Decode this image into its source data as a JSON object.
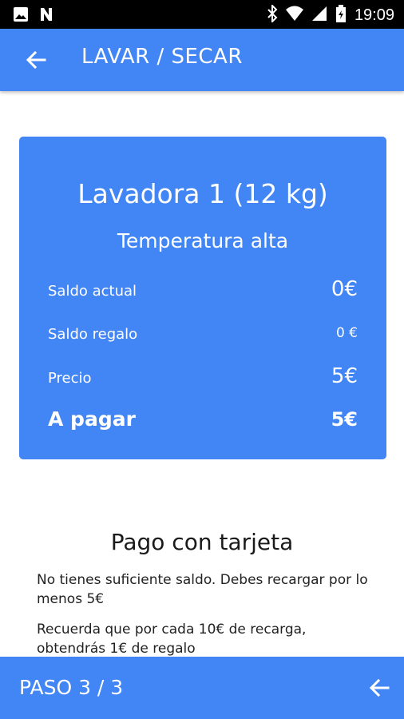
{
  "status_bar": {
    "time": "19:09",
    "icons": [
      "image-icon",
      "n-notification-icon",
      "bluetooth-icon",
      "wifi-icon",
      "signal-icon",
      "battery-icon"
    ]
  },
  "app_bar": {
    "title": "LAVAR / SECAR",
    "back_icon": "arrow-back-icon",
    "background": "#4285f4"
  },
  "summary_card": {
    "machine": "Lavadora 1 (12 kg)",
    "program": "Temperatura alta",
    "rows": [
      {
        "label": "Saldo actual",
        "value": "0€"
      },
      {
        "label": "Saldo regalo",
        "value": "0 €"
      },
      {
        "label": "Precio",
        "value": "5€"
      },
      {
        "label": "A pagar",
        "value": "5€"
      }
    ],
    "background": "#4285f4"
  },
  "payment": {
    "title": "Pago con tarjeta",
    "message_1": "No tienes suficiente saldo. Debes recargar por lo menos 5€",
    "message_2": "Recuerda que por cada 10€ de recarga, obtendrás 1€ de regalo"
  },
  "bottom_bar": {
    "step": "PASO 3 / 3",
    "nav_icon": "arrow-back-icon"
  }
}
